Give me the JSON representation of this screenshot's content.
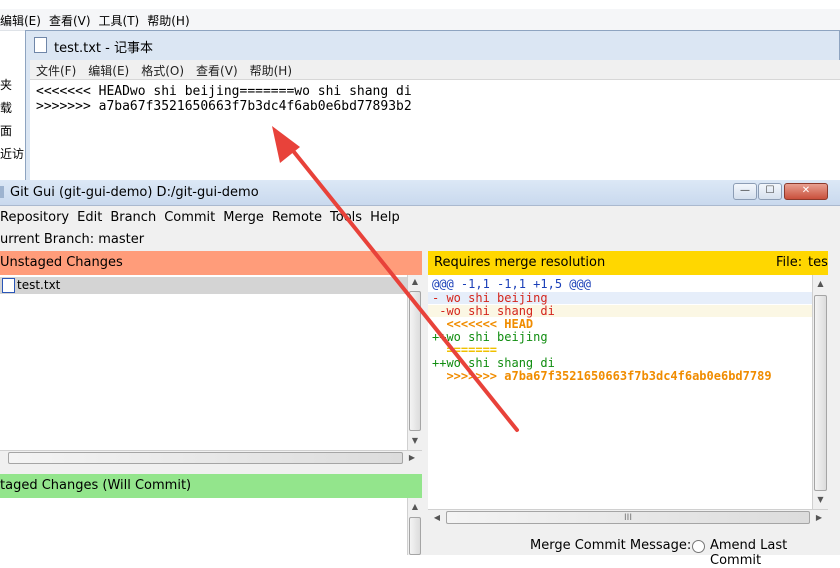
{
  "explorer_menu": [
    "编辑(E)",
    "查看(V)",
    "工具(T)",
    "帮助(H)"
  ],
  "explorer_nav": [
    "夹",
    "载",
    "面",
    "近访"
  ],
  "notepad": {
    "title": "test.txt - 记事本",
    "menu": [
      "文件(F)",
      "编辑(E)",
      "格式(O)",
      "查看(V)",
      "帮助(H)"
    ],
    "lines": [
      "<<<<<<< HEADwo shi beijing=======wo shi shang di",
      ">>>>>>> a7ba67f3521650663f7b3dc4f6ab0e6bd77893b2"
    ]
  },
  "gitgui": {
    "title": "Git Gui (git-gui-demo) D:/git-gui-demo",
    "menu": [
      "Repository",
      "Edit",
      "Branch",
      "Commit",
      "Merge",
      "Remote",
      "Tools",
      "Help"
    ],
    "branch_label": "urrent Branch: master",
    "unstaged_header": "Unstaged Changes",
    "unstaged_files": [
      "test.txt"
    ],
    "staged_header": "taged Changes (Will Commit)",
    "diff_header": "Requires merge resolution",
    "file_label": "File:",
    "file_value": "tes",
    "diff_lines": [
      "@@@ -1,1 -1,1 +1,5 @@@",
      "- wo shi beijing",
      " -wo shi shang di",
      "  <<<<<<< HEAD",
      "++wo shi beijing",
      "  =======",
      "++wo shi shang di",
      "  >>>>>>> a7ba67f3521650663f7b3dc4f6ab0e6bd7789"
    ],
    "hscroll_grip": "III",
    "commit_msg_label": "Merge Commit Message:",
    "amend_label": "Amend Last Commit"
  },
  "colors": {
    "unstaged": "#ff9c7a",
    "staged": "#93e58c",
    "merge": "#ffd700",
    "arrow": "#e8423a"
  }
}
